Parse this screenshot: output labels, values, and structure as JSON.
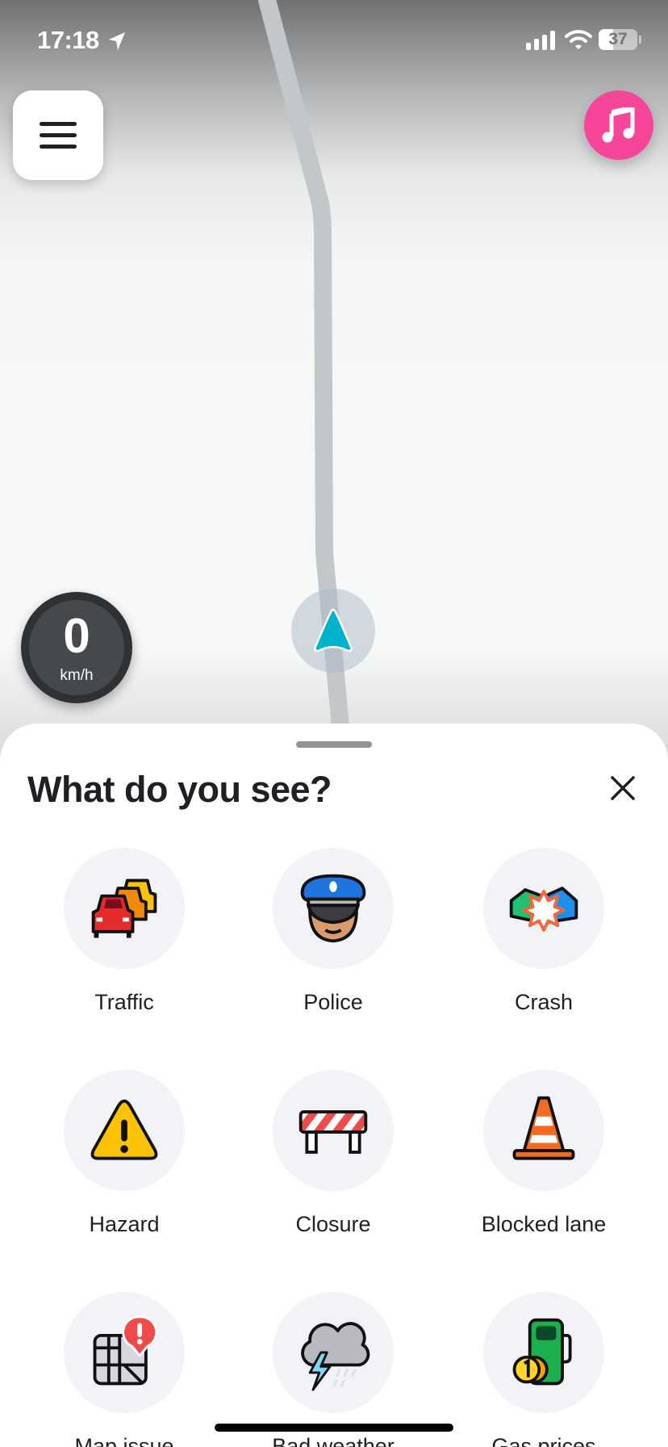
{
  "status_bar": {
    "time": "17:18",
    "battery": "37",
    "battery_level_percent": 37,
    "icons": [
      "location-arrow-icon",
      "signal-icon",
      "wifi-icon",
      "battery-icon"
    ]
  },
  "map": {
    "menu_icon": "hamburger-icon",
    "music_icon": "music-note-icon",
    "music_color": "#f7459a",
    "speed": {
      "value": "0",
      "unit": "km/h"
    },
    "position_icon": "navigation-arrow-icon",
    "accent": "#00b3cc"
  },
  "sheet": {
    "title": "What do you see?",
    "close_icon": "close-icon",
    "items": [
      {
        "label": "Traffic",
        "icon": "traffic-icon"
      },
      {
        "label": "Police",
        "icon": "police-icon"
      },
      {
        "label": "Crash",
        "icon": "crash-icon"
      },
      {
        "label": "Hazard",
        "icon": "hazard-icon"
      },
      {
        "label": "Closure",
        "icon": "closure-icon"
      },
      {
        "label": "Blocked lane",
        "icon": "blocked-lane-icon"
      },
      {
        "label": "Map issue",
        "icon": "map-issue-icon"
      },
      {
        "label": "Bad weather",
        "icon": "bad-weather-icon"
      },
      {
        "label": "Gas prices",
        "icon": "gas-prices-icon"
      }
    ]
  }
}
